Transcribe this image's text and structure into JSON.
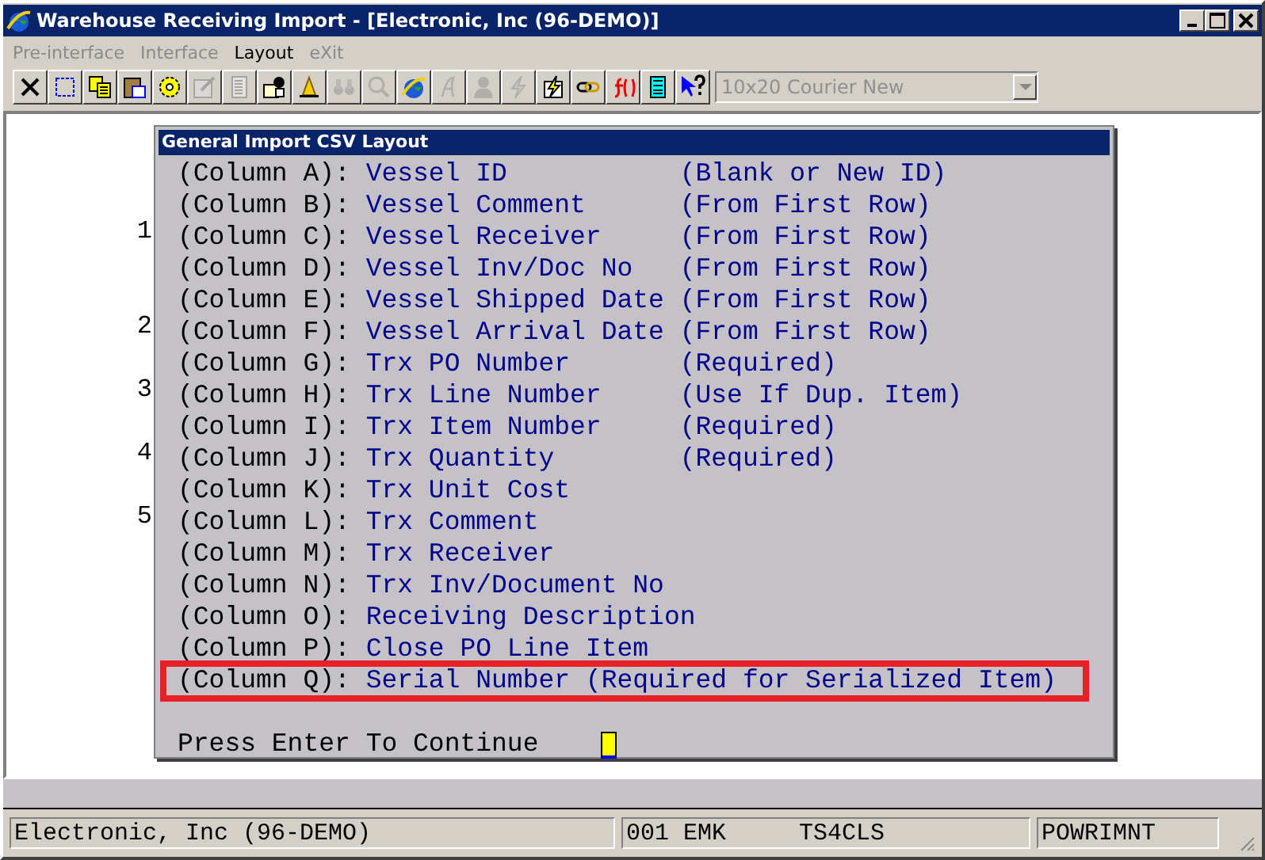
{
  "window": {
    "title": "Warehouse Receiving Import - [Electronic, Inc (96-DEMO)]"
  },
  "menu": [
    {
      "label": "Pre-interface",
      "disabled": true
    },
    {
      "label": "Interface",
      "disabled": true
    },
    {
      "label": "Layout",
      "disabled": false
    },
    {
      "label": "eXit",
      "disabled": true
    }
  ],
  "toolbar": [
    {
      "kind": "close",
      "disabled": false
    },
    {
      "kind": "select",
      "disabled": false
    },
    {
      "kind": "copy",
      "disabled": false
    },
    {
      "kind": "paste",
      "disabled": false
    },
    {
      "kind": "gear",
      "disabled": false
    },
    {
      "kind": "properties",
      "disabled": true
    },
    {
      "kind": "document",
      "disabled": true
    },
    {
      "kind": "contact",
      "disabled": false
    },
    {
      "kind": "cone",
      "disabled": false
    },
    {
      "kind": "binoculars",
      "disabled": true
    },
    {
      "kind": "search",
      "disabled": true
    },
    {
      "kind": "globe",
      "disabled": false
    },
    {
      "kind": "script",
      "disabled": true
    },
    {
      "kind": "person",
      "disabled": true
    },
    {
      "kind": "lightning",
      "disabled": true
    },
    {
      "kind": "lightning-document",
      "disabled": false
    },
    {
      "kind": "link",
      "disabled": false
    },
    {
      "kind": "function",
      "disabled": false
    },
    {
      "kind": "calculator",
      "disabled": false
    },
    {
      "kind": "help-pointer",
      "disabled": false
    }
  ],
  "font_dropdown": {
    "value": "10x20 Courier New",
    "disabled": true
  },
  "background_numbers": [
    "1",
    "2",
    "3",
    "4",
    "5"
  ],
  "dialog": {
    "title": "General Import CSV Layout",
    "rows": [
      {
        "column": "(Column A):",
        "field": "Vessel ID",
        "note": "(Blank or New ID)",
        "highlighted": false
      },
      {
        "column": "(Column B):",
        "field": "Vessel Comment",
        "note": "(From First Row)",
        "highlighted": false
      },
      {
        "column": "(Column C):",
        "field": "Vessel Receiver",
        "note": "(From First Row)",
        "highlighted": false
      },
      {
        "column": "(Column D):",
        "field": "Vessel Inv/Doc No",
        "note": "(From First Row)",
        "highlighted": false
      },
      {
        "column": "(Column E):",
        "field": "Vessel Shipped Date",
        "note": "(From First Row)",
        "highlighted": false
      },
      {
        "column": "(Column F):",
        "field": "Vessel Arrival Date",
        "note": "(From First Row)",
        "highlighted": false
      },
      {
        "column": "(Column G):",
        "field": "Trx PO Number",
        "note": "(Required)",
        "highlighted": false
      },
      {
        "column": "(Column H):",
        "field": "Trx Line Number",
        "note": "(Use If Dup. Item)",
        "highlighted": false
      },
      {
        "column": "(Column I):",
        "field": "Trx Item Number",
        "note": "(Required)",
        "highlighted": false
      },
      {
        "column": "(Column J):",
        "field": "Trx Quantity",
        "note": "(Required)",
        "highlighted": false
      },
      {
        "column": "(Column K):",
        "field": "Trx Unit Cost",
        "highlighted": false
      },
      {
        "column": "(Column L):",
        "field": "Trx Comment",
        "highlighted": false
      },
      {
        "column": "(Column M):",
        "field": "Trx Receiver",
        "highlighted": false
      },
      {
        "column": "(Column N):",
        "field": "Trx Inv/Document No",
        "highlighted": false
      },
      {
        "column": "(Column O):",
        "field": "Receiving Description",
        "highlighted": false
      },
      {
        "column": "(Column P):",
        "field": "Close PO Line Item",
        "highlighted": false
      },
      {
        "column": "(Column Q):",
        "field": "Serial Number (Required for Serialized Item)",
        "highlighted": true
      }
    ],
    "prompt": "Press Enter To Continue"
  },
  "status_bar": {
    "company": "Electronic, Inc (96-DEMO)",
    "user": "001 EMK",
    "terminal": "TS4CLS",
    "program": "POWRIMNT"
  }
}
